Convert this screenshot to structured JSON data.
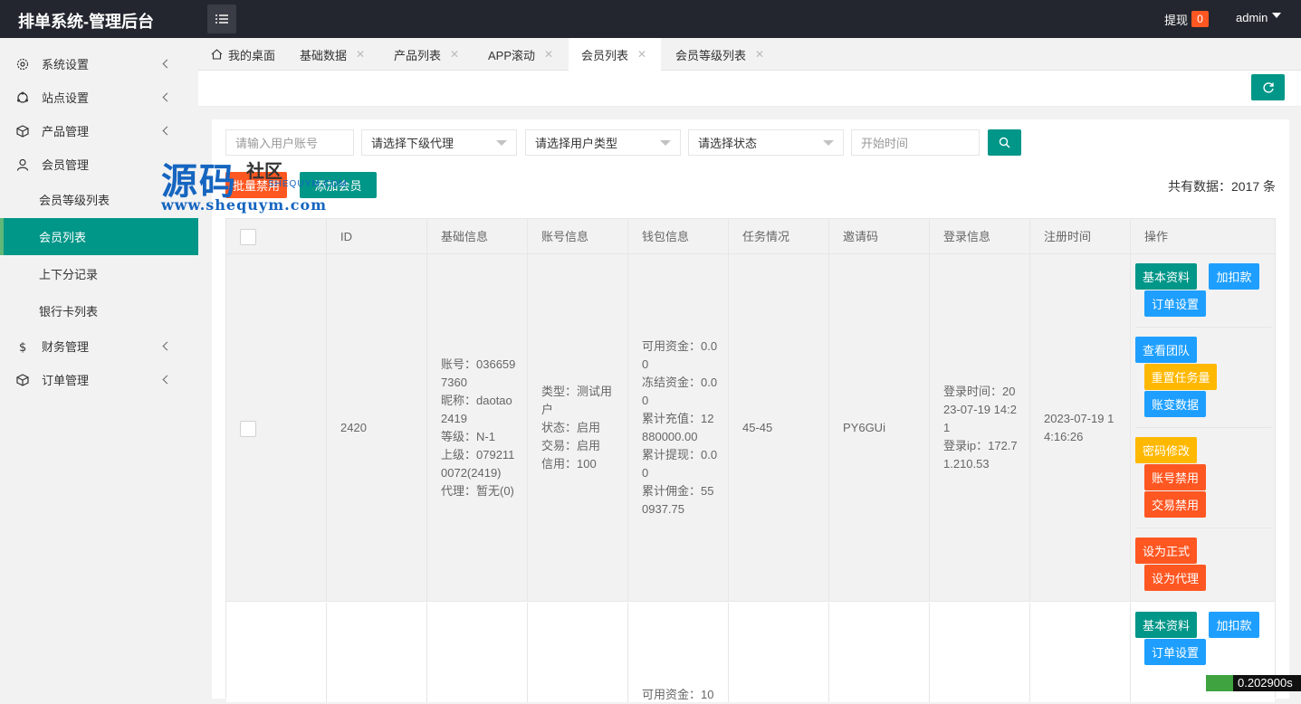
{
  "header": {
    "title": "排单系统-管理后台",
    "withdraw_label": "提现",
    "withdraw_count": "0",
    "user": "admin"
  },
  "sidebar": {
    "items": [
      {
        "label": "系统设置",
        "icon": "gear-icon"
      },
      {
        "label": "站点设置",
        "icon": "site-icon"
      },
      {
        "label": "产品管理",
        "icon": "cube-icon"
      },
      {
        "label": "会员管理",
        "icon": "user-icon"
      },
      {
        "label": "财务管理",
        "icon": "dollar-icon"
      },
      {
        "label": "订单管理",
        "icon": "cube-icon"
      }
    ],
    "sub_items": [
      "会员等级列表",
      "会员列表",
      "上下分记录",
      "银行卡列表"
    ]
  },
  "tabs": [
    {
      "label": "我的桌面"
    },
    {
      "label": "基础数据"
    },
    {
      "label": "产品列表"
    },
    {
      "label": "APP滚动"
    },
    {
      "label": "会员列表"
    },
    {
      "label": "会员等级列表"
    }
  ],
  "filters": {
    "account_placeholder": "请输入用户账号",
    "agent": "请选择下级代理",
    "user_type": "请选择用户类型",
    "status": "请选择状态",
    "start_time_placeholder": "开始时间"
  },
  "actions": {
    "batch_disable": "批量禁用",
    "add_member": "添加会员",
    "total": "共有数据：2017 条"
  },
  "watermark": {
    "main": "源码",
    "sub": "社区",
    "en": "SHEQUYM.COM",
    "url": "www.shequym.com"
  },
  "table": {
    "headers": [
      "ID",
      "基础信息",
      "账号信息",
      "钱包信息",
      "任务情况",
      "邀请码",
      "登录信息",
      "注册时间",
      "操作"
    ],
    "rows": [
      {
        "id": "2420",
        "basic": [
          "账号：036659",
          "7360",
          "昵称：daotao",
          "2419",
          "等级：N-1",
          "上级：079211",
          "0072(2419)",
          "代理：暂无(0)"
        ],
        "account": [
          "类型：测试用",
          "户",
          "状态：启用",
          "交易：启用",
          "信用：100"
        ],
        "wallet": [
          "可用资金：0.0",
          "0",
          "冻结资金：0.0",
          "0",
          "累计充值：12",
          "880000.00",
          "累计提现：0.0",
          "0",
          "累计佣金：55",
          "0937.75"
        ],
        "task": "45-45",
        "invite": "PY6GUi",
        "login": [
          "登录时间：20",
          "23-07-19 14:2",
          "1",
          "登录ip：172.7",
          "1.210.53"
        ],
        "register": [
          "2023-07-19 1",
          "4:16:26"
        ]
      },
      {
        "wallet_partial": "可用资金：10"
      }
    ],
    "ops": {
      "basic_info": "基本资料",
      "add_deduct": "加扣款",
      "order_settings": "订单设置",
      "view_team": "查看团队",
      "reset_tasks": "重置任务量",
      "account_changes": "账变数据",
      "change_password": "密码修改",
      "disable_account": "账号禁用",
      "disable_trade": "交易禁用",
      "set_official": "设为正式",
      "set_agent": "设为代理"
    }
  },
  "footer": {
    "timer": "0.202900s"
  }
}
